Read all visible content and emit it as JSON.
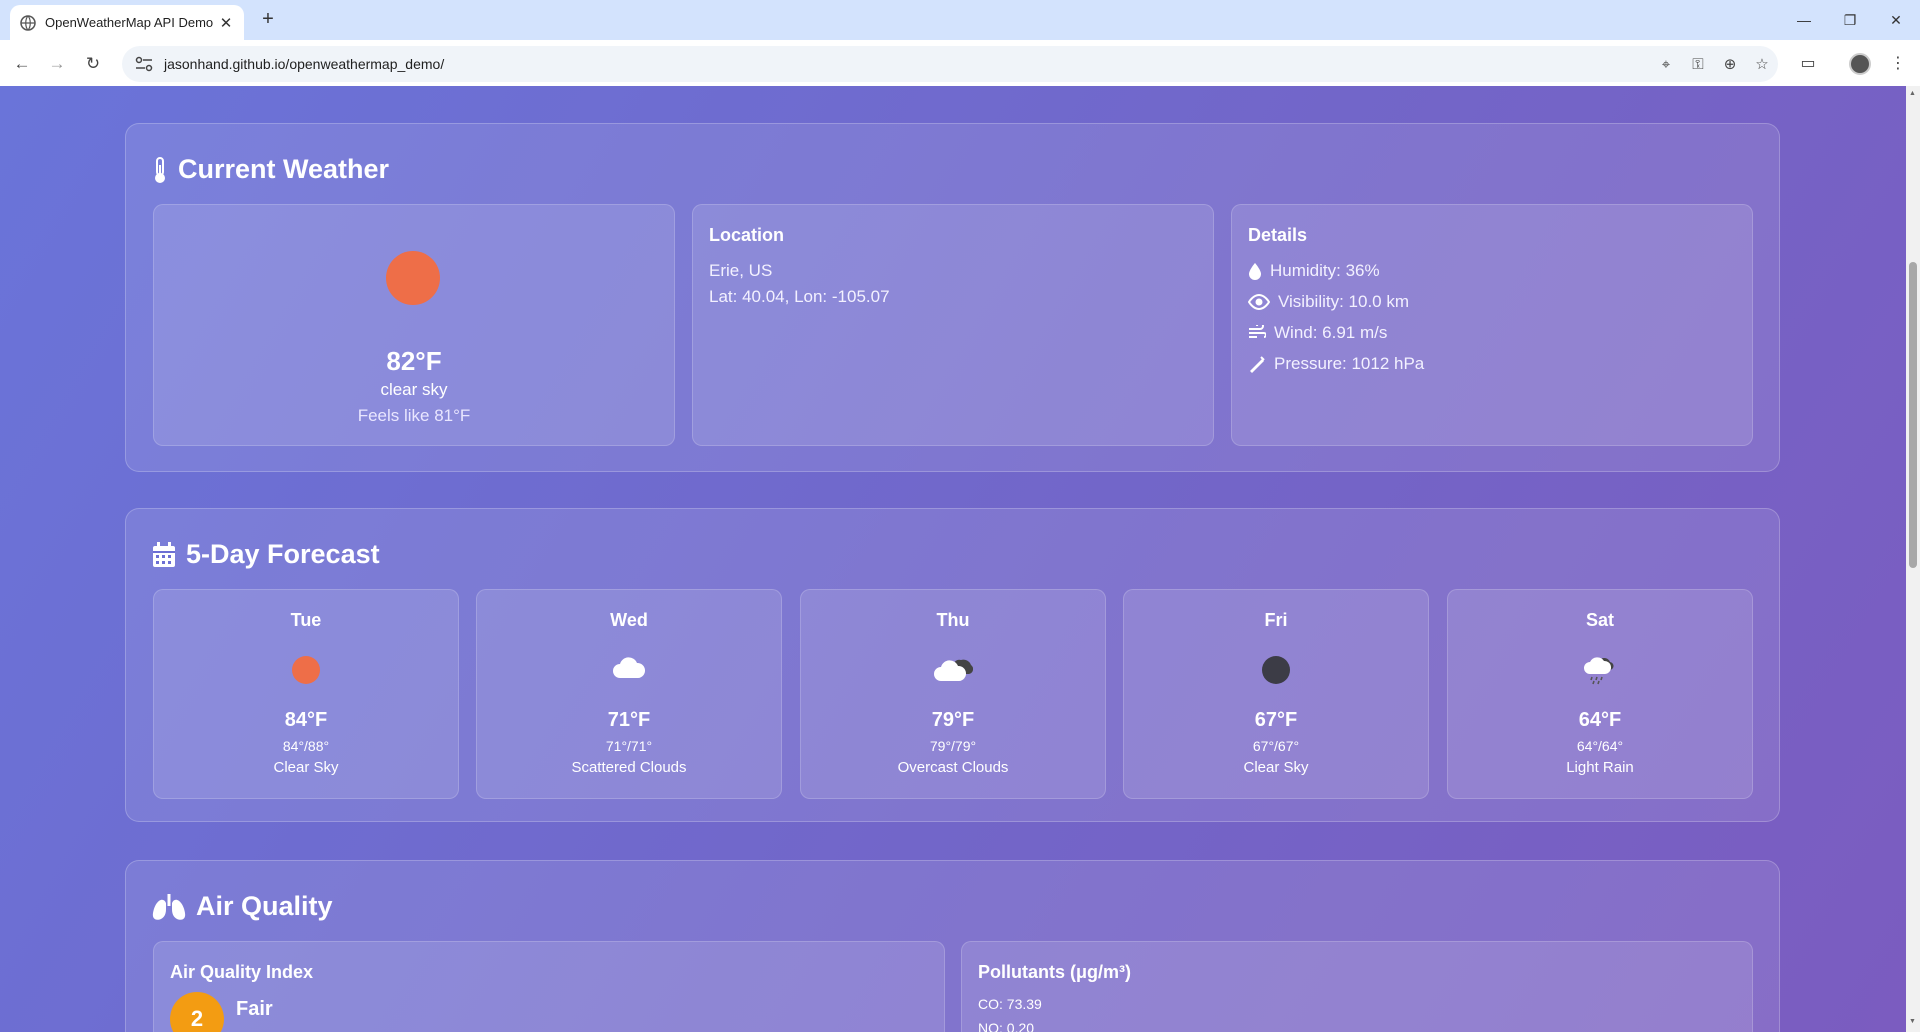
{
  "browser": {
    "tab_title": "OpenWeatherMap API Demo",
    "url": "jasonhand.github.io/openweathermap_demo/"
  },
  "current": {
    "heading": "Current Weather",
    "temp": "82°F",
    "condition": "clear sky",
    "feels_like": "Feels like 81°F",
    "location_heading": "Location",
    "city": "Erie, US",
    "coords": "Lat: 40.04, Lon: -105.07",
    "details_heading": "Details",
    "humidity": "Humidity: 36%",
    "visibility": "Visibility: 10.0 km",
    "wind": "Wind: 6.91 m/s",
    "pressure": "Pressure: 1012 hPa",
    "icon": "sun-icon",
    "sun_color": "#ee6e48"
  },
  "forecast": {
    "heading": "5-Day Forecast",
    "days": [
      {
        "day": "Tue",
        "temp": "84°F",
        "hilo": "84°/88°",
        "desc": "Clear Sky",
        "icon": "sun-icon"
      },
      {
        "day": "Wed",
        "temp": "71°F",
        "hilo": "71°/71°",
        "desc": "Scattered Clouds",
        "icon": "cloud-icon"
      },
      {
        "day": "Thu",
        "temp": "79°F",
        "hilo": "79°/79°",
        "desc": "Overcast Clouds",
        "icon": "overcast-clouds-icon"
      },
      {
        "day": "Fri",
        "temp": "67°F",
        "hilo": "67°/67°",
        "desc": "Clear Sky",
        "icon": "moon-icon"
      },
      {
        "day": "Sat",
        "temp": "64°F",
        "hilo": "64°/64°",
        "desc": "Light Rain",
        "icon": "rain-cloud-icon"
      }
    ]
  },
  "air": {
    "heading": "Air Quality",
    "index_heading": "Air Quality Index",
    "aqi": "2",
    "aqi_label": "Fair",
    "pollutants_heading": "Pollutants (μg/m³)",
    "co": "CO: 73.39",
    "no": "NO: 0.20",
    "aqi_color": "#f39c12"
  }
}
